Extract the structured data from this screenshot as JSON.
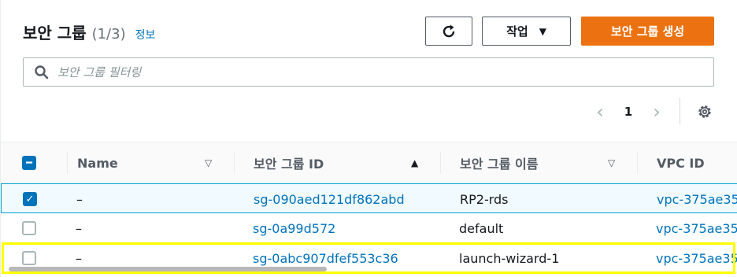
{
  "header": {
    "title": "보안 그룹",
    "count": "(1/3)",
    "info_link": "정보"
  },
  "toolbar": {
    "actions_label": "작업",
    "create_label": "보안 그룹 생성"
  },
  "search": {
    "placeholder": "보안 그룹 필터링",
    "value": ""
  },
  "pagination": {
    "current_page": "1"
  },
  "table": {
    "columns": [
      {
        "label": "Name",
        "sort": "none"
      },
      {
        "label": "보안 그룹 ID",
        "sort": "ascending"
      },
      {
        "label": "보안 그룹 이름",
        "sort": "none"
      },
      {
        "label": "VPC ID",
        "sort": "none"
      }
    ],
    "rows": [
      {
        "selected": true,
        "name": "–",
        "group_id": "sg-090aed121df862abd",
        "group_name": "RP2-rds",
        "vpc_id": "vpc-375ae35"
      },
      {
        "selected": false,
        "name": "–",
        "group_id": "sg-0a99d572",
        "group_name": "default",
        "vpc_id": "vpc-375ae35"
      },
      {
        "selected": false,
        "name": "–",
        "group_id": "sg-0abc907dfef553c36",
        "group_name": "launch-wizard-1",
        "vpc_id": "vpc-375ae35"
      }
    ]
  },
  "colors": {
    "accent": "#ec7211",
    "link": "#0073bb",
    "highlight": "#ffff00"
  },
  "icons": {
    "refresh": "refresh-icon",
    "caret": "caret-down-icon",
    "search": "search-icon",
    "prev": "chevron-left-icon",
    "next": "chevron-right-icon",
    "settings": "gear-icon"
  }
}
